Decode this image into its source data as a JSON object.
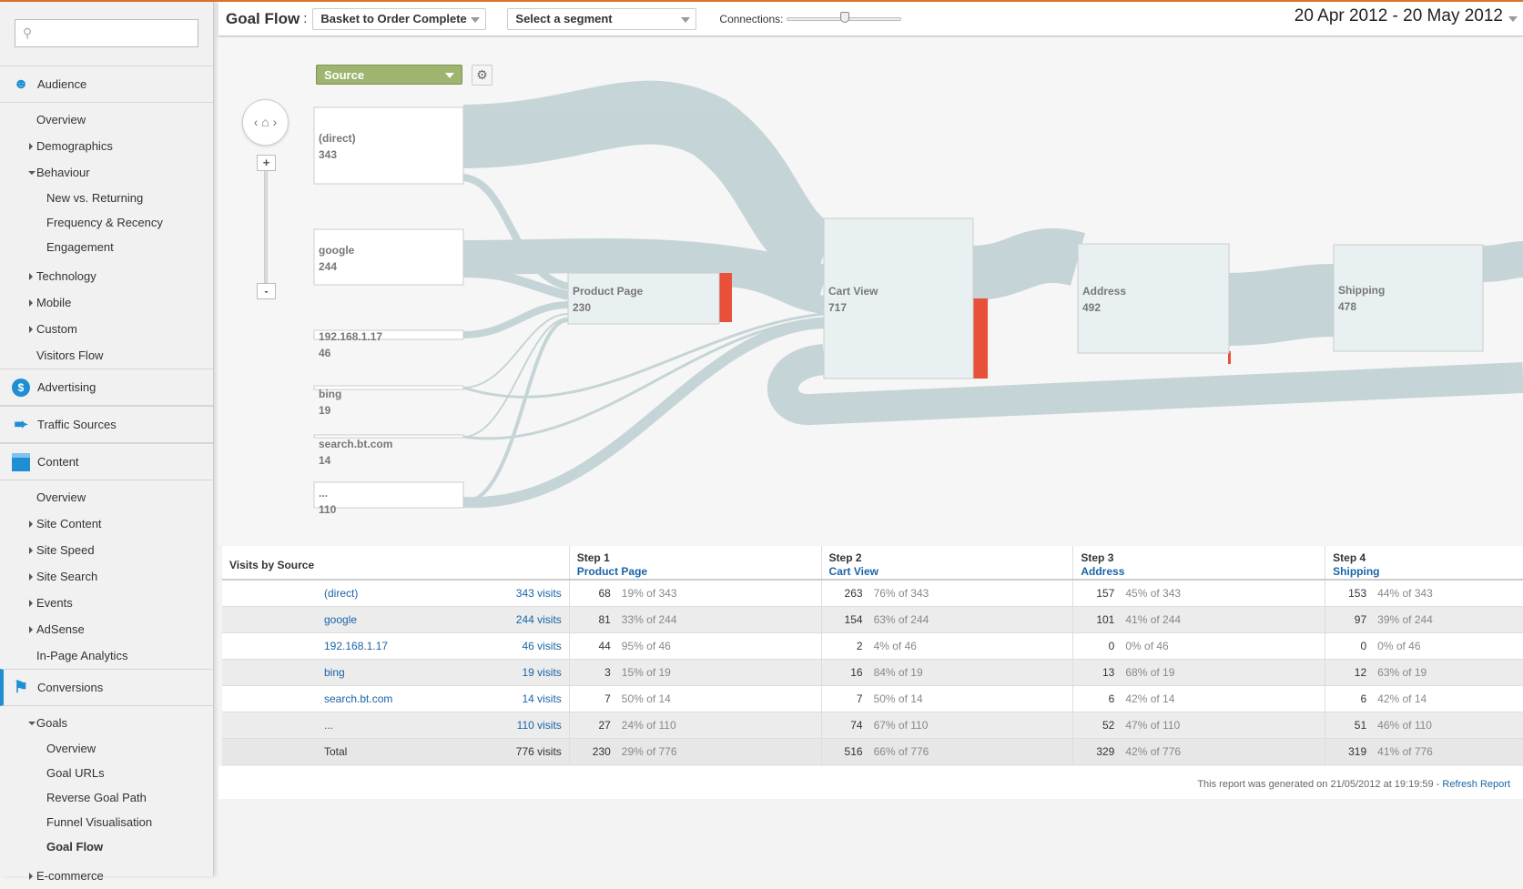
{
  "sidebar": {
    "search_placeholder": "",
    "sections": [
      {
        "label": "Audience",
        "items": [
          {
            "label": "Overview"
          },
          {
            "label": "Demographics"
          },
          {
            "label": "Behaviour"
          },
          {
            "label": "New vs. Returning"
          },
          {
            "label": "Frequency & Recency"
          },
          {
            "label": "Engagement"
          },
          {
            "label": "Technology"
          },
          {
            "label": "Mobile"
          },
          {
            "label": "Custom"
          },
          {
            "label": "Visitors Flow"
          }
        ]
      },
      {
        "label": "Advertising"
      },
      {
        "label": "Traffic Sources"
      },
      {
        "label": "Content",
        "items": [
          {
            "label": "Overview"
          },
          {
            "label": "Site Content"
          },
          {
            "label": "Site Speed"
          },
          {
            "label": "Site Search"
          },
          {
            "label": "Events"
          },
          {
            "label": "AdSense"
          },
          {
            "label": "In-Page Analytics"
          }
        ]
      },
      {
        "label": "Conversions",
        "items": [
          {
            "label": "Goals"
          },
          {
            "label": "Overview"
          },
          {
            "label": "Goal URLs"
          },
          {
            "label": "Reverse Goal Path"
          },
          {
            "label": "Funnel Visualisation"
          },
          {
            "label": "Goal Flow"
          },
          {
            "label": "E-commerce"
          }
        ]
      }
    ]
  },
  "topbar": {
    "title": "Goal Flow",
    "title_sep": ":",
    "goal": "Basket to Order Complete",
    "segment": "Select a segment",
    "connections_label": "Connections:",
    "connections_level": 0.5,
    "date_range": "20 Apr 2012 - 20 May 2012"
  },
  "flow": {
    "dimension": "Source",
    "zoom_in": "+",
    "zoom_out": "-",
    "sources": [
      {
        "label": "(direct)",
        "value": "343"
      },
      {
        "label": "google",
        "value": "244"
      },
      {
        "label": "192.168.1.17",
        "value": "46"
      },
      {
        "label": "bing",
        "value": "19"
      },
      {
        "label": "search.bt.com",
        "value": "14"
      },
      {
        "label": "...",
        "value": "110"
      }
    ],
    "steps": [
      {
        "label": "Product Page",
        "value": "230"
      },
      {
        "label": "Cart View",
        "value": "717"
      },
      {
        "label": "Address",
        "value": "492"
      },
      {
        "label": "Shipping",
        "value": "478"
      }
    ]
  },
  "table": {
    "header": {
      "source": "Visits by Source",
      "steps": [
        {
          "step": "Step 1",
          "name": "Product Page"
        },
        {
          "step": "Step 2",
          "name": "Cart View"
        },
        {
          "step": "Step 3",
          "name": "Address"
        },
        {
          "step": "Step 4",
          "name": "Shipping"
        }
      ]
    },
    "rows": [
      {
        "source": "(direct)",
        "visits": "343 visits",
        "steps": [
          [
            "68",
            "19% of 343"
          ],
          [
            "263",
            "76% of 343"
          ],
          [
            "157",
            "45% of 343"
          ],
          [
            "153",
            "44% of 343"
          ]
        ]
      },
      {
        "source": "google",
        "visits": "244 visits",
        "steps": [
          [
            "81",
            "33% of 244"
          ],
          [
            "154",
            "63% of 244"
          ],
          [
            "101",
            "41% of 244"
          ],
          [
            "97",
            "39% of 244"
          ]
        ]
      },
      {
        "source": "192.168.1.17",
        "visits": "46 visits",
        "steps": [
          [
            "44",
            "95% of 46"
          ],
          [
            "2",
            "4% of 46"
          ],
          [
            "0",
            "0% of 46"
          ],
          [
            "0",
            "0% of 46"
          ]
        ]
      },
      {
        "source": "bing",
        "visits": "19 visits",
        "steps": [
          [
            "3",
            "15% of 19"
          ],
          [
            "16",
            "84% of 19"
          ],
          [
            "13",
            "68% of 19"
          ],
          [
            "12",
            "63% of 19"
          ]
        ]
      },
      {
        "source": "search.bt.com",
        "visits": "14 visits",
        "steps": [
          [
            "7",
            "50% of 14"
          ],
          [
            "7",
            "50% of 14"
          ],
          [
            "6",
            "42% of 14"
          ],
          [
            "6",
            "42% of 14"
          ]
        ]
      },
      {
        "source": "...",
        "visits": "110 visits",
        "steps": [
          [
            "27",
            "24% of 110"
          ],
          [
            "74",
            "67% of 110"
          ],
          [
            "52",
            "47% of 110"
          ],
          [
            "51",
            "46% of 110"
          ]
        ]
      }
    ],
    "total": {
      "source": "Total",
      "visits": "776 visits",
      "steps": [
        [
          "230",
          "29% of 776"
        ],
        [
          "516",
          "66% of 776"
        ],
        [
          "329",
          "42% of 776"
        ],
        [
          "319",
          "41% of 776"
        ]
      ]
    }
  },
  "footer": {
    "text": "This report was generated on 21/05/2012 at 19:19:59 - ",
    "link": "Refresh Report"
  }
}
